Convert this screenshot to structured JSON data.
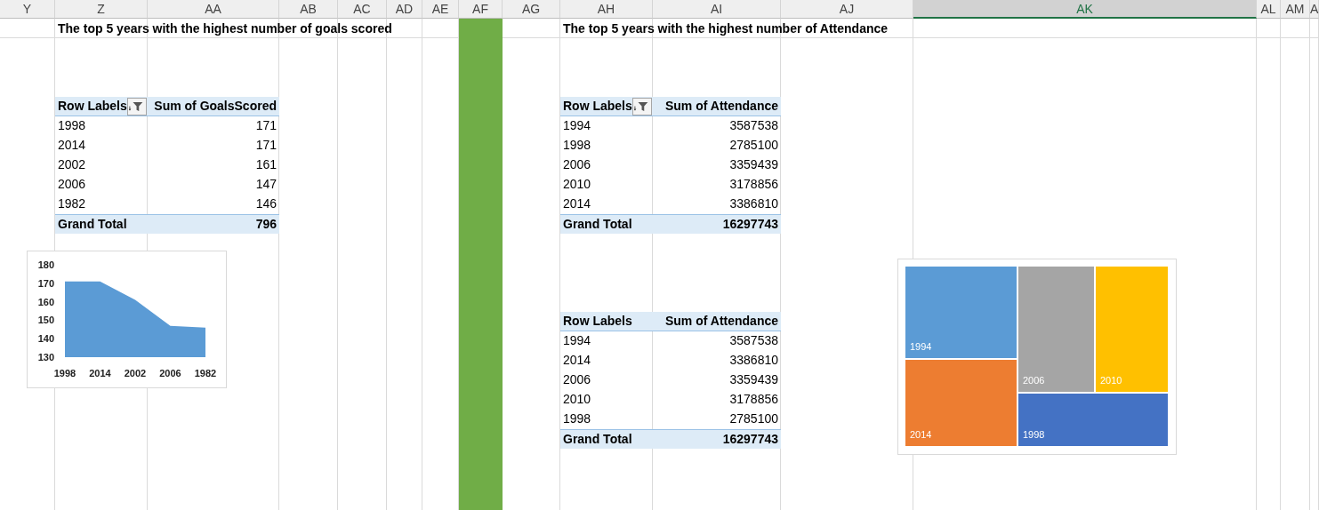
{
  "columns": [
    {
      "label": "Y",
      "selected": false,
      "filled": false
    },
    {
      "label": "Z",
      "selected": false,
      "filled": false
    },
    {
      "label": "AA",
      "selected": false,
      "filled": false
    },
    {
      "label": "AB",
      "selected": false,
      "filled": false
    },
    {
      "label": "AC",
      "selected": false,
      "filled": false
    },
    {
      "label": "AD",
      "selected": false,
      "filled": false
    },
    {
      "label": "AE",
      "selected": false,
      "filled": false
    },
    {
      "label": "AF",
      "selected": false,
      "filled": true
    },
    {
      "label": "AG",
      "selected": false,
      "filled": false
    },
    {
      "label": "AH",
      "selected": false,
      "filled": false
    },
    {
      "label": "AI",
      "selected": false,
      "filled": false
    },
    {
      "label": "AJ",
      "selected": false,
      "filled": false
    },
    {
      "label": "AK",
      "selected": true,
      "filled": false
    },
    {
      "label": "AL",
      "selected": false,
      "filled": false
    },
    {
      "label": "AM",
      "selected": false,
      "filled": false
    },
    {
      "label": "A",
      "selected": false,
      "filled": false
    }
  ],
  "left_section": {
    "title": "The top 5 years with the highest number of goals scored",
    "pivot": {
      "header": {
        "row_label": "Row Labels",
        "value_label": "Sum of GoalsScored",
        "filter_button": true
      },
      "rows": [
        {
          "label": "1998",
          "value": "171"
        },
        {
          "label": "2014",
          "value": "171"
        },
        {
          "label": "2002",
          "value": "161"
        },
        {
          "label": "2006",
          "value": "147"
        },
        {
          "label": "1982",
          "value": "146"
        }
      ],
      "grand_total": {
        "label": "Grand Total",
        "value": "796"
      }
    },
    "chart_data": {
      "type": "area",
      "categories": [
        "1998",
        "2014",
        "2002",
        "2006",
        "1982"
      ],
      "series": [
        {
          "color": "#5b9bd5",
          "values": [
            171,
            171,
            161,
            147,
            146
          ]
        }
      ],
      "ylim": [
        130,
        180
      ],
      "yticks": [
        130,
        140,
        150,
        160,
        170,
        180
      ]
    }
  },
  "right_section": {
    "title": "The top 5 years with the highest number of Attendance",
    "pivots": [
      {
        "header": {
          "row_label": "Row Labels",
          "value_label": "Sum of Attendance",
          "filter_button": true
        },
        "rows": [
          {
            "label": "1994",
            "value": "3587538"
          },
          {
            "label": "1998",
            "value": "2785100"
          },
          {
            "label": "2006",
            "value": "3359439"
          },
          {
            "label": "2010",
            "value": "3178856"
          },
          {
            "label": "2014",
            "value": "3386810"
          }
        ],
        "grand_total": {
          "label": "Grand Total",
          "value": "16297743"
        }
      },
      {
        "header": {
          "row_label": "Row Labels",
          "value_label": "Sum of Attendance"
        },
        "rows": [
          {
            "label": "1994",
            "value": "3587538"
          },
          {
            "label": "2014",
            "value": "3386810"
          },
          {
            "label": "2006",
            "value": "3359439"
          },
          {
            "label": "2010",
            "value": "3178856"
          },
          {
            "label": "1998",
            "value": "2785100"
          }
        ],
        "grand_total": {
          "label": "Grand Total",
          "value": "16297743"
        }
      }
    ],
    "treemap": {
      "tiles": [
        {
          "label": "1994",
          "color": "#5b9bd5"
        },
        {
          "label": "2014",
          "color": "#ed7d31"
        },
        {
          "label": "2006",
          "color": "#a5a5a5"
        },
        {
          "label": "2010",
          "color": "#ffc000"
        },
        {
          "label": "1998",
          "color": "#4472c4"
        }
      ]
    }
  }
}
